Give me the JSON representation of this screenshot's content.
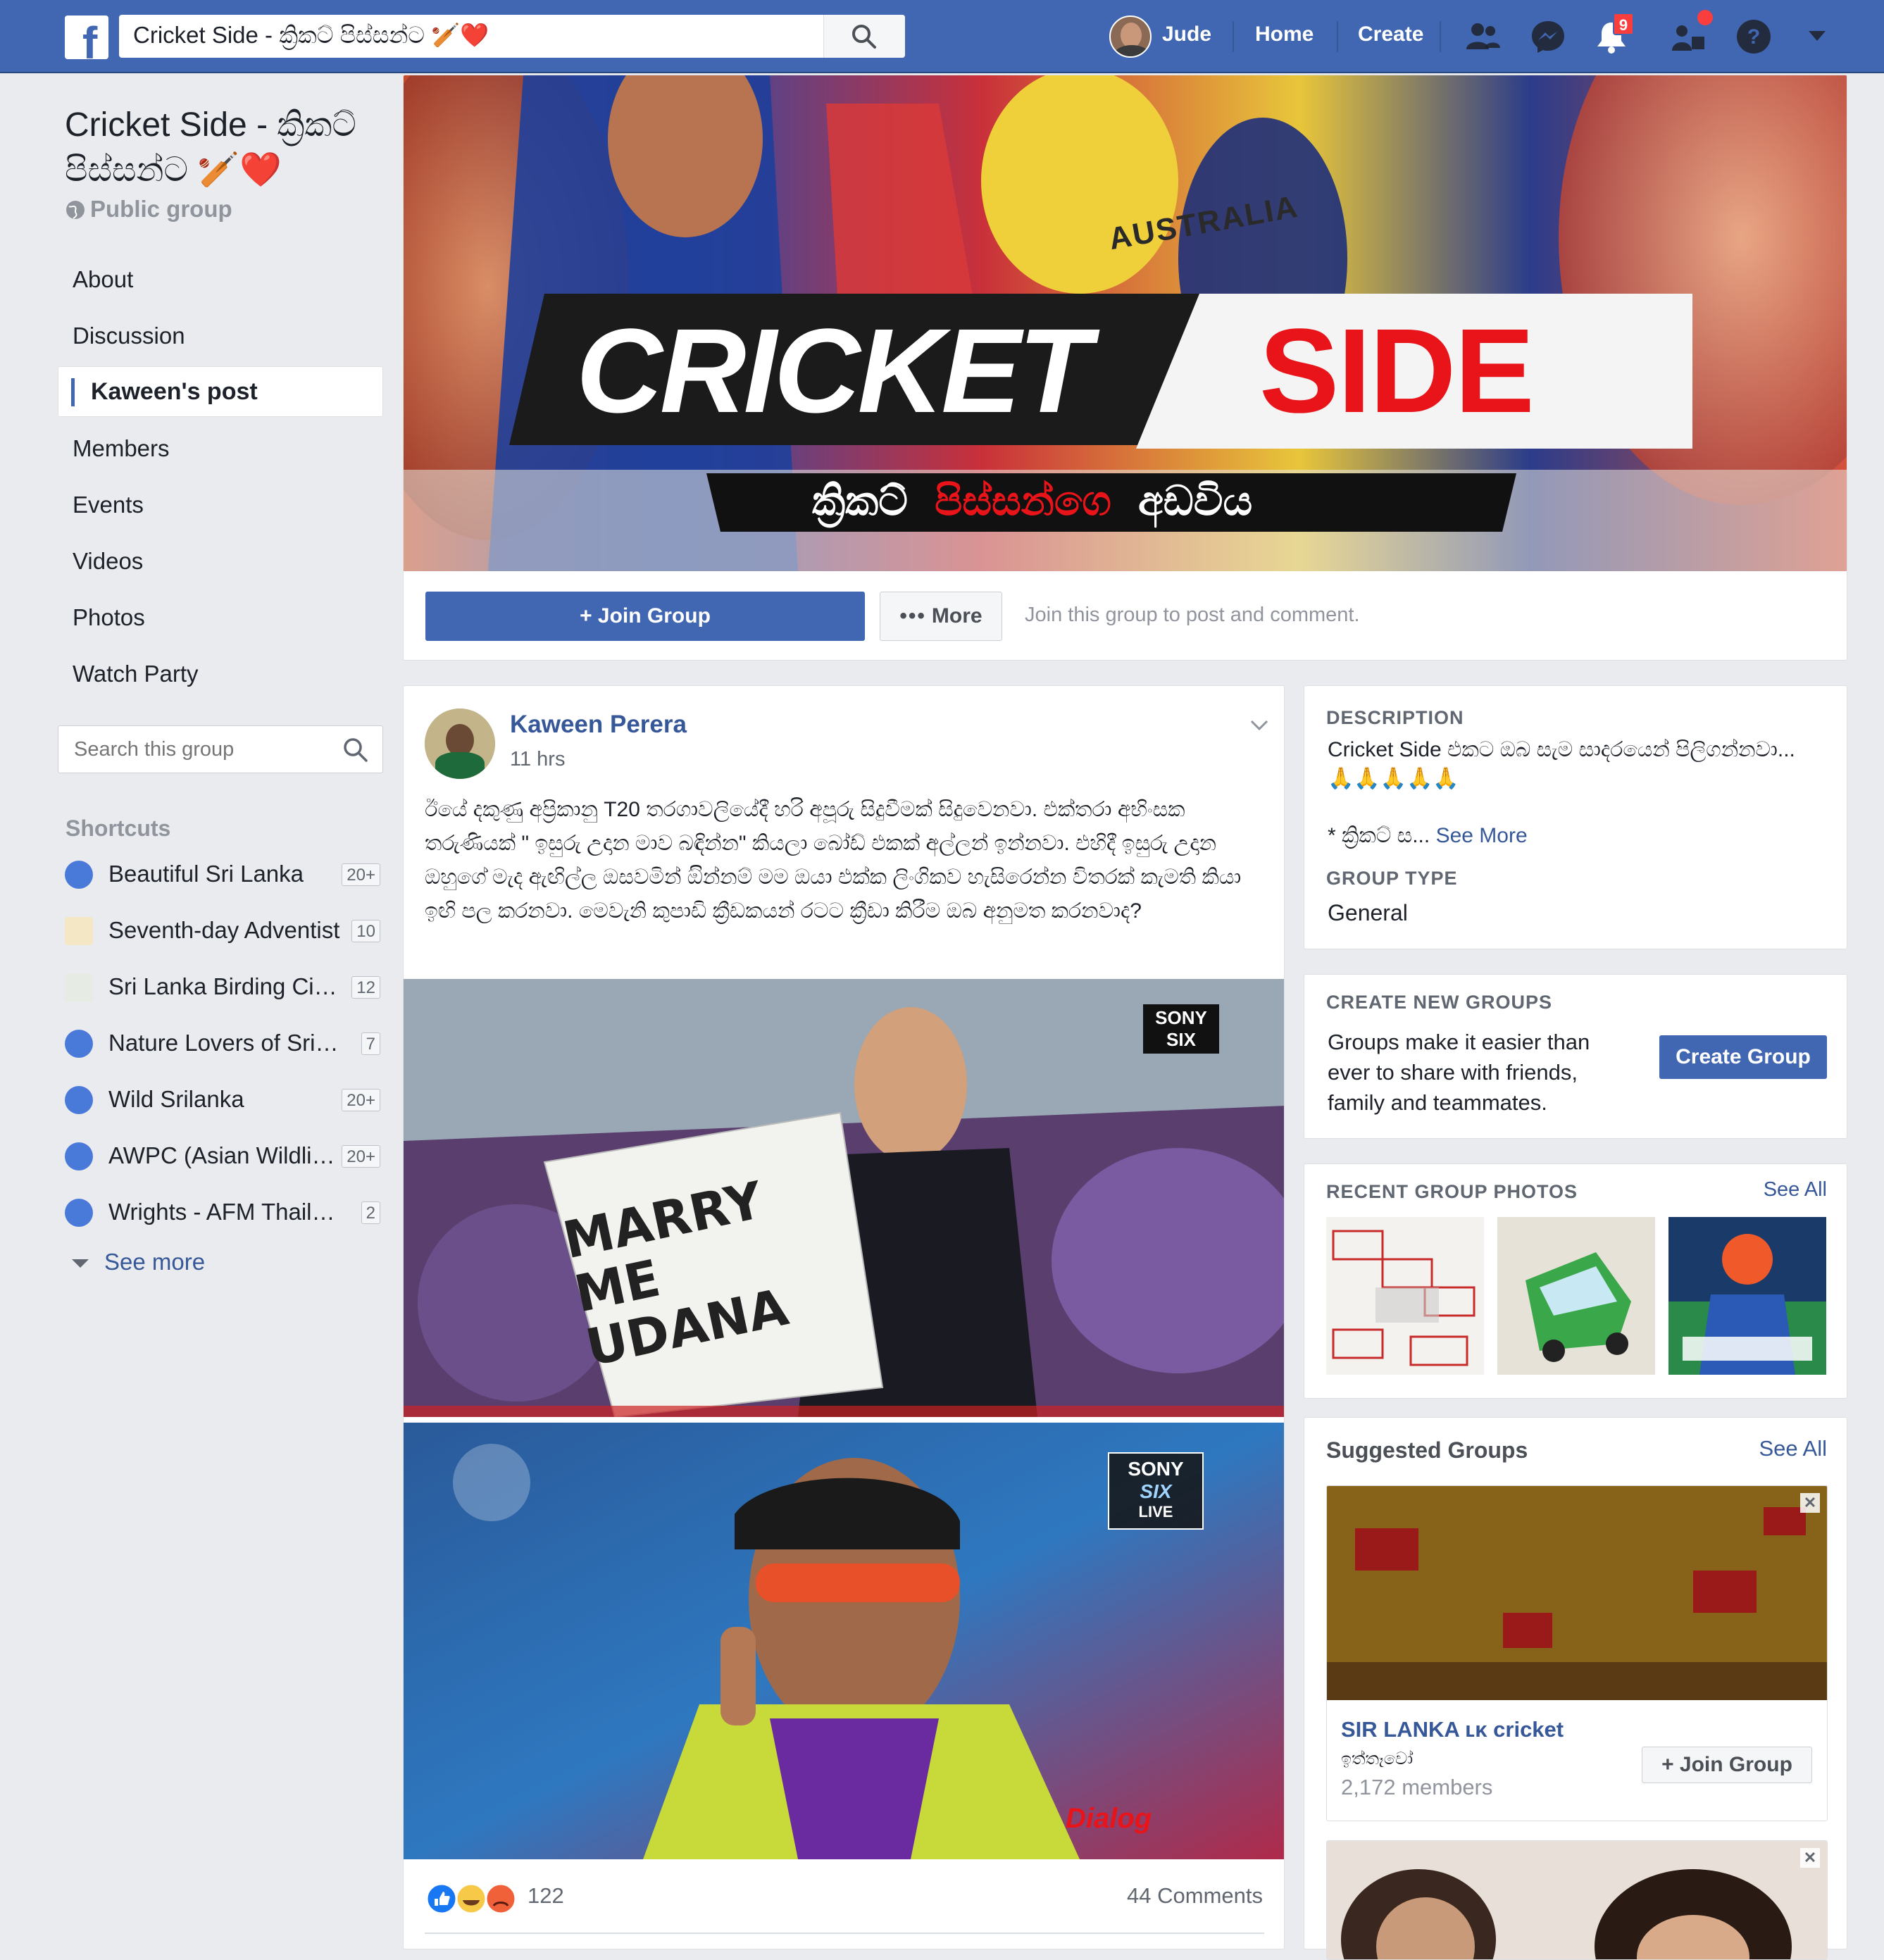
{
  "topbar": {
    "search_value": "Cricket Side - ක්‍රිකට් පිස්සන්ට 🏏❤️",
    "user_name": "Jude",
    "nav_home": "Home",
    "nav_create": "Create",
    "notification_count": "9",
    "brand_color": "#4267b2"
  },
  "group": {
    "title": "Cricket Side - ක්‍රිකට් පිස්සන්ට 🏏❤️",
    "privacy": "Public group"
  },
  "leftnav": {
    "items": [
      "About",
      "Discussion",
      "Kaween's post",
      "Members",
      "Events",
      "Videos",
      "Photos",
      "Watch Party"
    ],
    "active": "Kaween's post",
    "search_placeholder": "Search this group"
  },
  "shortcuts": {
    "title": "Shortcuts",
    "items": [
      {
        "label": "Beautiful Sri Lanka",
        "badge": "20+"
      },
      {
        "label": "Seventh-day Adventist",
        "badge": "10"
      },
      {
        "label": "Sri Lanka Birding Circle",
        "badge": "12"
      },
      {
        "label": "Nature Lovers of Sri Lanka",
        "badge": "7"
      },
      {
        "label": "Wild Srilanka",
        "badge": "20+"
      },
      {
        "label": "AWPC (Asian Wildlife Photographers)",
        "badge": "20+"
      },
      {
        "label": "Wrights - AFM Thailand",
        "badge": "2"
      }
    ],
    "see_more": "See more"
  },
  "cover": {
    "title_left": "CRICKET",
    "title_right": "SIDE",
    "subtitle_a": "ක්‍රිකට්",
    "subtitle_b": "පිස්සන්ගෙ",
    "subtitle_c": "අඩවිය",
    "shirt_text": "AUSTRALIA",
    "join_label": "+ Join Group",
    "more_label": "More",
    "join_hint": "Join this group to post and comment."
  },
  "post": {
    "author": "Kaween Perera",
    "time": "11 hrs",
    "text": "ඊයේ දකුණු අප්‍රිකානු T20 තරගාවලියේදී හරි අපූරු සිදුවීමක් සිදුවෙනවා. එක්තරා අභිංසක තරුණියක් \" ඉසුරු උදාන මාව බඳින්න\" කියලා බෝඩ් එකක් අල්ලන් ඉන්නවා. එහිදී ඉසුරු උදාන ඔහුගේ මැද ඇඟිල්ල ඔසවමින් ඔින්නම් මම ඔයා එක්ක ලිංගිකව හැසිරෙන්න විතරක් කැමති කියා ඉඟි පල කරනවා. මෙවැනි කුපාඩි ක්‍රීඩකයන් රටට ක්‍රීඩා කිරීම ඔබ අනුමත කරනවාද?",
    "photo1_sign": "MARRY ME UDANA",
    "photo1_logo": "SONY SIX",
    "photo2_logo_a": "SONY",
    "photo2_logo_b": "SIX",
    "photo2_logo_c": "LIVE",
    "photo2_sponsor": "Dialog",
    "reaction_count": "122",
    "comment_count": "44 Comments"
  },
  "description": {
    "head": "DESCRIPTION",
    "text": "Cricket Side එකට ඔබ සැම සාදරයෙන් පිලිගන්නවා...",
    "emoji": "🙏🙏🙏🙏🙏",
    "snippet": "* ක්‍රිකට් ස...",
    "see_more": "See More",
    "type_head": "GROUP TYPE",
    "type_value": "General"
  },
  "create_groups": {
    "head": "CREATE NEW GROUPS",
    "text": "Groups make it easier than ever to share with friends, family and teammates.",
    "button": "Create Group"
  },
  "recent_photos": {
    "head": "RECENT GROUP PHOTOS",
    "see_all": "See All"
  },
  "suggested": {
    "head": "Suggested Groups",
    "see_all": "See All",
    "group_name": "SIR LANKA ʟᴋ cricket",
    "group_sub": "ඉත්තෑවෝ",
    "members": "2,172 members",
    "join": "+ Join Group"
  }
}
